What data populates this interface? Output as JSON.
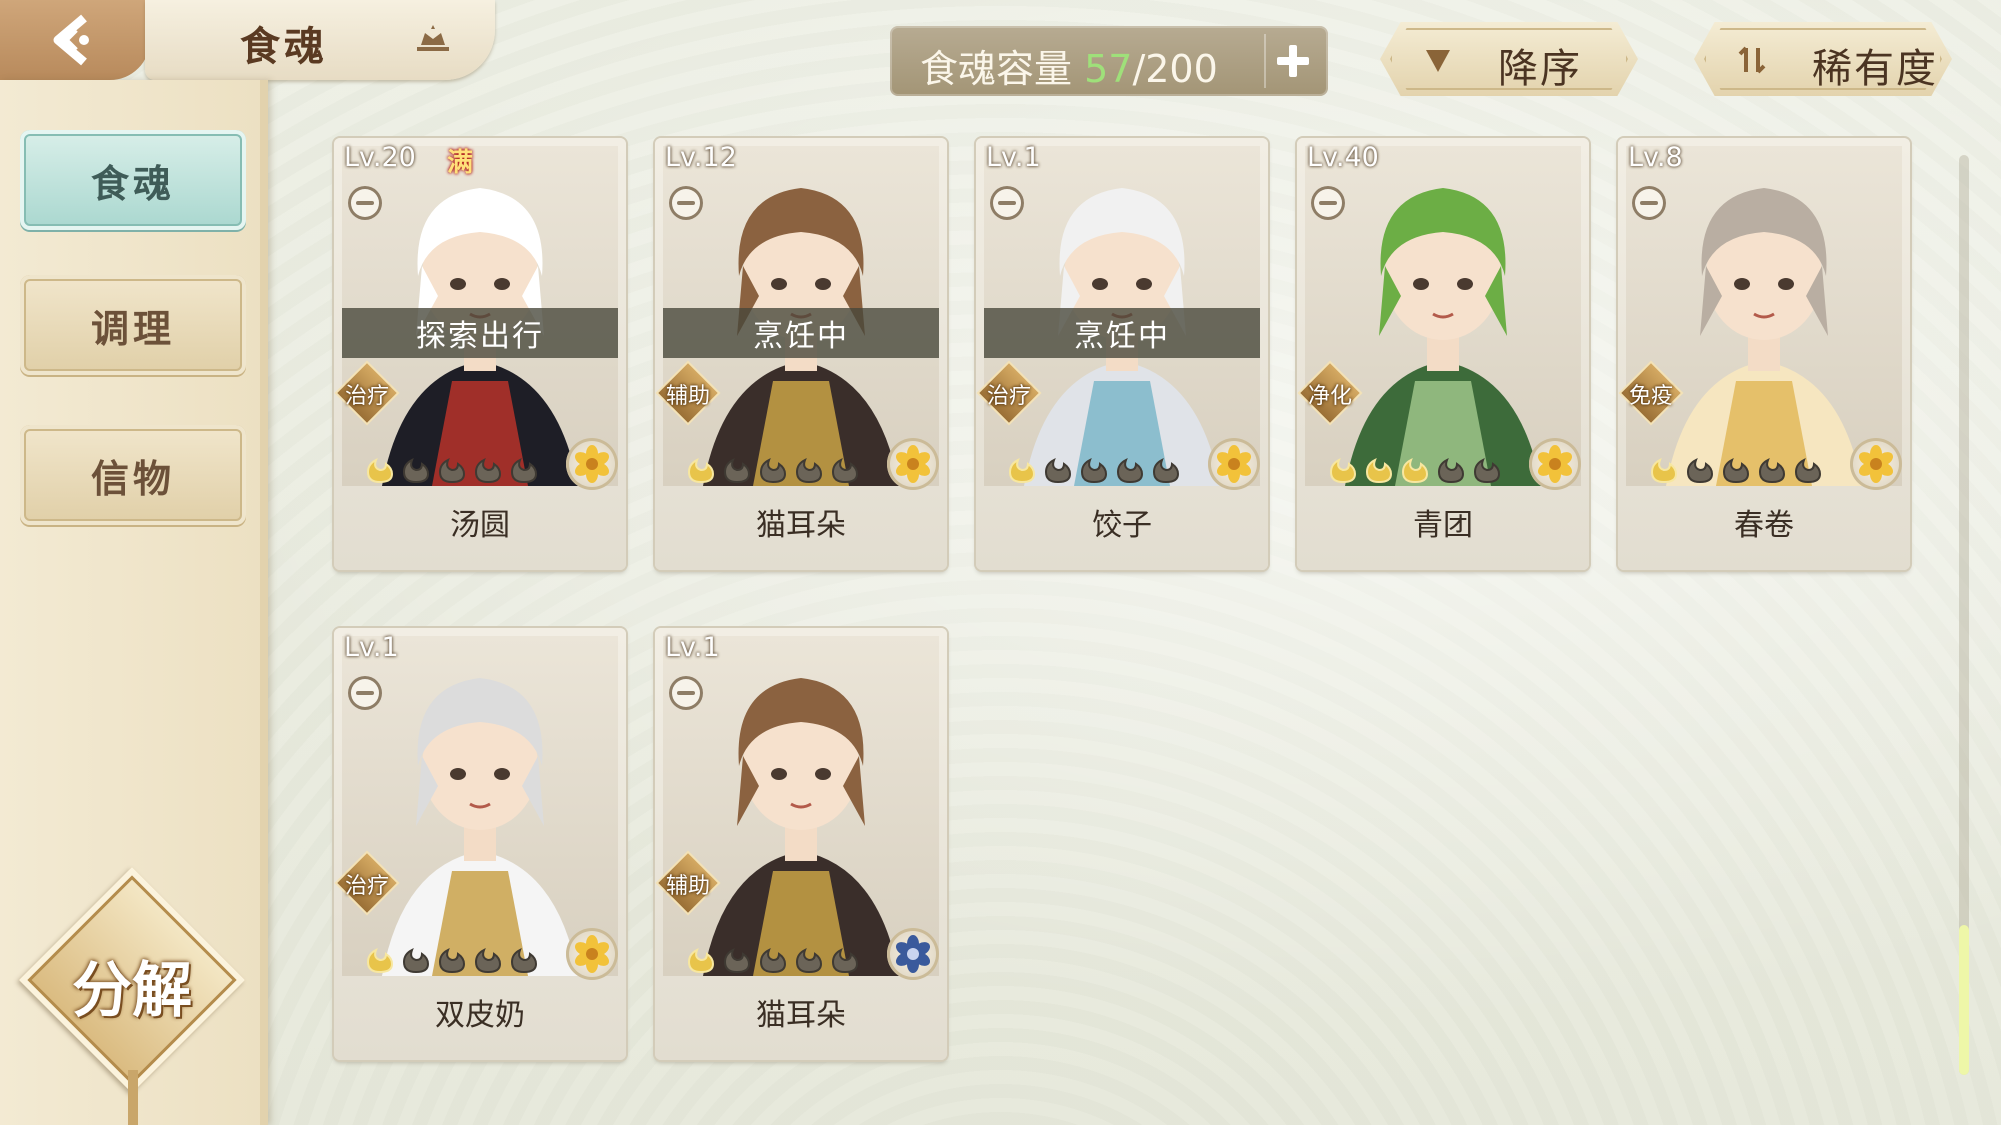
{
  "header": {
    "title": "食魂",
    "capacity": {
      "label": "食魂容量 ",
      "current": "57",
      "max": "/200"
    },
    "sort_order": "降序",
    "sort_key": "稀有度"
  },
  "sidebar": {
    "items": [
      {
        "label": "食魂",
        "active": true
      },
      {
        "label": "调理",
        "active": false
      },
      {
        "label": "信物",
        "active": false
      }
    ],
    "decompose": "分解"
  },
  "cards": [
    {
      "level": "Lv.20",
      "max": "满",
      "status": "探索出行",
      "role": "治疗",
      "stars": 1,
      "name": "汤圆",
      "rarity": "gold",
      "palette": [
        "#ffffff",
        "#1e1e26",
        "#b7332a"
      ]
    },
    {
      "level": "Lv.12",
      "status": "烹饪中",
      "role": "辅助",
      "stars": 1,
      "name": "猫耳朵",
      "rarity": "gold",
      "palette": [
        "#8b6240",
        "#3a2e2a",
        "#c9a245"
      ]
    },
    {
      "level": "Lv.1",
      "status": "烹饪中",
      "role": "治疗",
      "stars": 1,
      "name": "饺子",
      "rarity": "gold",
      "palette": [
        "#f1f1f1",
        "#e0e3e8",
        "#7db7c9"
      ]
    },
    {
      "level": "Lv.40",
      "role": "净化",
      "stars": 3,
      "name": "青团",
      "rarity": "gold",
      "palette": [
        "#6cae45",
        "#3d6b3a",
        "#9ec489"
      ]
    },
    {
      "level": "Lv.8",
      "role": "免疫",
      "stars": 1,
      "name": "春卷",
      "rarity": "gold",
      "palette": [
        "#b9aea2",
        "#f6e6c0",
        "#e2b85a"
      ]
    },
    {
      "level": "Lv.1",
      "role": "治疗",
      "stars": 1,
      "name": "双皮奶",
      "rarity": "gold",
      "palette": [
        "#dcdcdc",
        "#f5f5f5",
        "#c9a24a"
      ]
    },
    {
      "level": "Lv.1",
      "role": "辅助",
      "stars": 1,
      "name": "猫耳朵",
      "rarity": "blue",
      "palette": [
        "#8b6240",
        "#3a2e2a",
        "#c9a245"
      ]
    }
  ],
  "colors": {
    "accent": "#9fe07a",
    "brown": "#5a3a22",
    "gold": "#d4a962",
    "teal": "#a9d7cf"
  }
}
